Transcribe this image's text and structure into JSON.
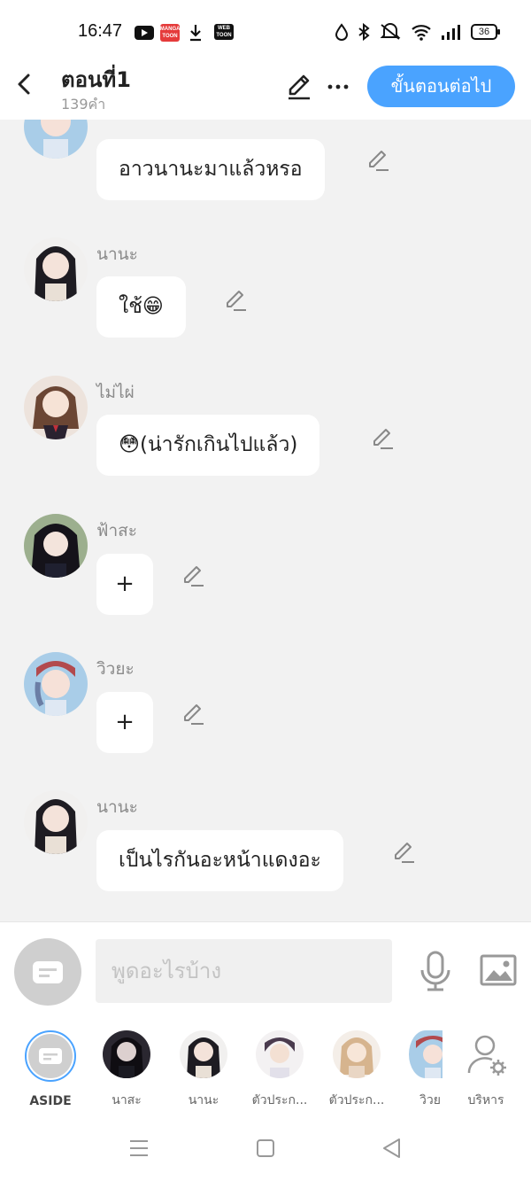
{
  "status": {
    "time": "16:47",
    "battery": "36",
    "manga_badge": "MANGA TOON",
    "webtoon_badge": "WEB TOON"
  },
  "header": {
    "title": "ตอนที่1",
    "word_count": "139คำ",
    "next_button": "ขั้นตอนต่อไป"
  },
  "messages": [
    {
      "speaker": "",
      "text": "อาวนานะมาแล้วหรอ"
    },
    {
      "speaker": "นานะ",
      "text": "ใช้😁"
    },
    {
      "speaker": "ไม่ไผ่",
      "text": "😳(น่ารักเกินไปแล้ว)"
    },
    {
      "speaker": "ฟ้าสะ",
      "text": "+"
    },
    {
      "speaker": "วิวยะ",
      "text": "+"
    },
    {
      "speaker": "นานะ",
      "text": "เป็นไรกันอะหน้าแดงอะ"
    }
  ],
  "input": {
    "placeholder": "พูดอะไรบ้าง"
  },
  "characters": [
    {
      "name": "ASIDE"
    },
    {
      "name": "นาสะ"
    },
    {
      "name": "นานะ"
    },
    {
      "name": "ตัวประก..."
    },
    {
      "name": "ตัวประก..."
    },
    {
      "name": "วิวย"
    },
    {
      "name": "บริหาร"
    }
  ],
  "colors": {
    "accent": "#4aa3ff",
    "background": "#f2f2f2",
    "bubble": "#ffffff"
  }
}
